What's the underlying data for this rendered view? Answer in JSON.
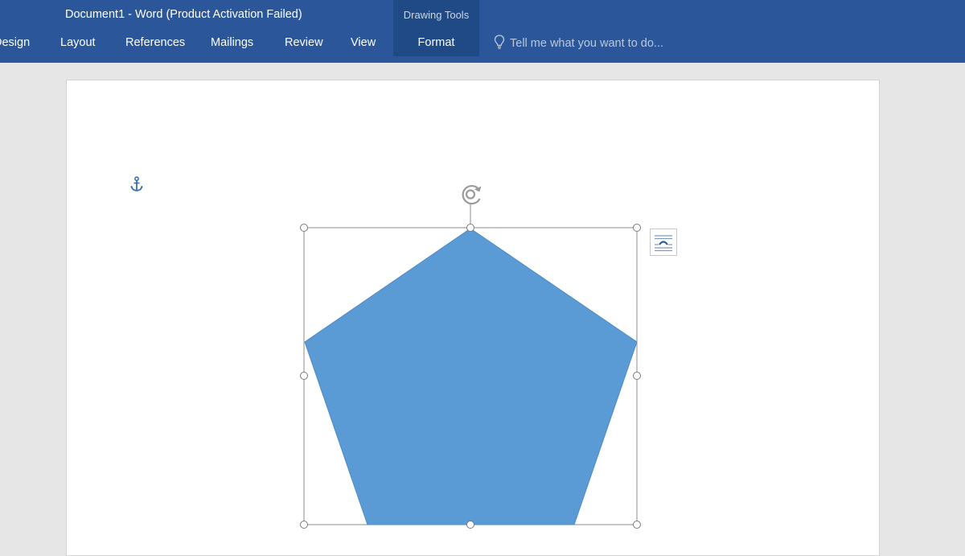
{
  "window": {
    "title": "Document1 - Word (Product Activation Failed)"
  },
  "ribbon": {
    "tabs": [
      {
        "label": "Design"
      },
      {
        "label": "Layout"
      },
      {
        "label": "References"
      },
      {
        "label": "Mailings"
      },
      {
        "label": "Review"
      },
      {
        "label": "View"
      }
    ],
    "context_group": {
      "label": "Drawing Tools",
      "tab_label": "Format"
    },
    "tell_me": {
      "placeholder": "Tell me what you want to do...",
      "icon": "lightbulb-icon"
    },
    "accent_color": "#2b579a",
    "context_color": "#1f4a86"
  },
  "document": {
    "shape": {
      "type": "pentagon",
      "fill_color": "#5b9bd5",
      "selected": true
    },
    "icons": {
      "anchor": "anchor-icon",
      "rotate": "rotate-handle-icon",
      "layout_options": "layout-options-icon"
    }
  }
}
